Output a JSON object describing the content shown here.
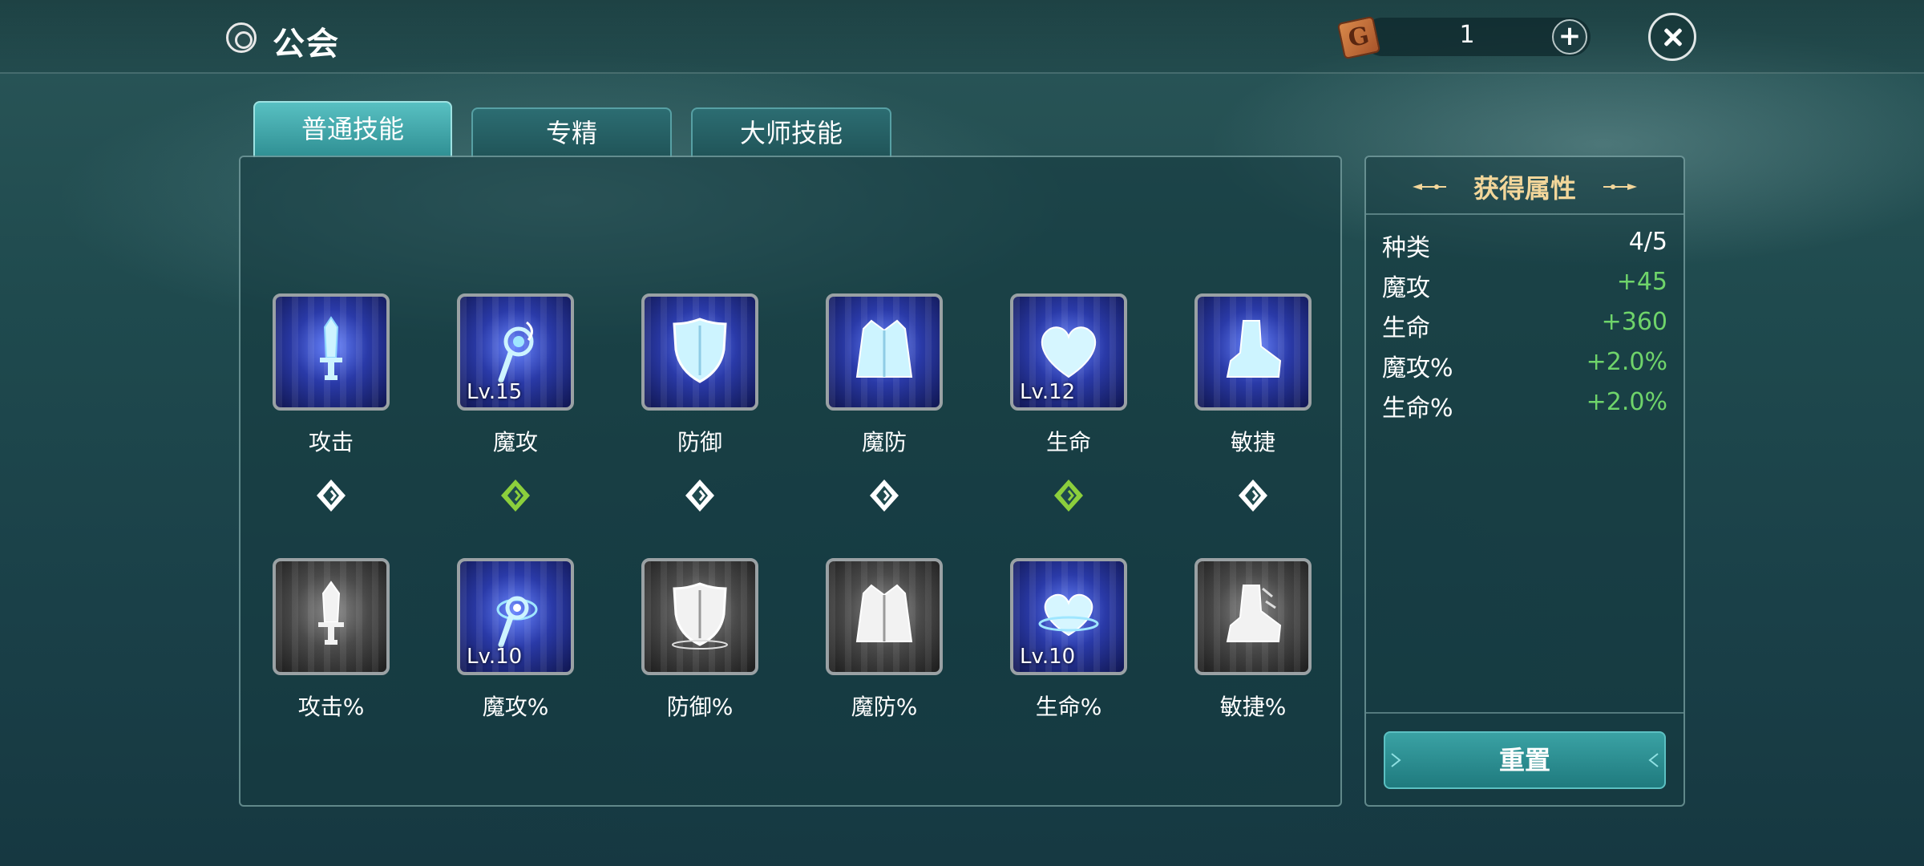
{
  "header": {
    "title": "公会",
    "currency_symbol": "G",
    "currency_value": "1",
    "add_label": "+"
  },
  "tabs": [
    {
      "label": "普通技能",
      "active": true
    },
    {
      "label": "专精",
      "active": false
    },
    {
      "label": "大师技能",
      "active": false
    }
  ],
  "skills_row1": [
    {
      "label": "攻击",
      "level": "",
      "icon": "sword-icon",
      "active": true,
      "gem": "white"
    },
    {
      "label": "魔攻",
      "level": "Lv.15",
      "icon": "magic-staff-icon",
      "active": true,
      "gem": "green"
    },
    {
      "label": "防御",
      "level": "",
      "icon": "shield-icon",
      "active": true,
      "gem": "white"
    },
    {
      "label": "魔防",
      "level": "",
      "icon": "cloak-icon",
      "active": true,
      "gem": "white"
    },
    {
      "label": "生命",
      "level": "Lv.12",
      "icon": "heart-icon",
      "active": true,
      "gem": "green"
    },
    {
      "label": "敏捷",
      "level": "",
      "icon": "boot-icon",
      "active": true,
      "gem": "white"
    }
  ],
  "skills_row2": [
    {
      "label": "攻击%",
      "level": "",
      "icon": "sword-icon",
      "active": false
    },
    {
      "label": "魔攻%",
      "level": "Lv.10",
      "icon": "magic-staff-icon",
      "active": true
    },
    {
      "label": "防御%",
      "level": "",
      "icon": "shield-icon",
      "active": false
    },
    {
      "label": "魔防%",
      "level": "",
      "icon": "cloak-icon",
      "active": false
    },
    {
      "label": "生命%",
      "level": "Lv.10",
      "icon": "heart-icon",
      "active": true
    },
    {
      "label": "敏捷%",
      "level": "",
      "icon": "boot-icon",
      "active": false
    }
  ],
  "side_panel": {
    "title": "获得属性",
    "attributes": [
      {
        "name": "种类",
        "value": "4/5"
      },
      {
        "name": "魔攻",
        "value": "+45"
      },
      {
        "name": "生命",
        "value": "+360"
      },
      {
        "name": "魔攻%",
        "value": "+2.0%"
      },
      {
        "name": "生命%",
        "value": "+2.0%"
      }
    ],
    "reset_label": "重置"
  },
  "colors": {
    "accent_teal": "#3aa2a4",
    "gem_green": "#8ccf3c",
    "bonus_green": "#6fd46a",
    "title_gold": "#f2d69a"
  }
}
